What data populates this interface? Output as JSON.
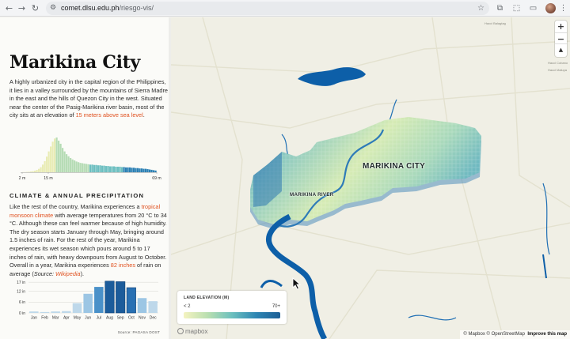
{
  "browser": {
    "url_host": "comet.dlsu.edu.ph",
    "url_path": "/riesgo-vis/",
    "back_glyph": "←",
    "forward_glyph": "→",
    "reload_glyph": "↻",
    "tune_glyph": "⚙",
    "star_glyph": "☆",
    "ext_glyph": "⧉",
    "ext2_glyph": "⬚",
    "sidebar_glyph": "▭",
    "menu_glyph": "⋮"
  },
  "panel": {
    "title": "Marikina City",
    "intro_pre": "A highly urbanized city in the capital region of the Philippines, it lies in a valley surrounded by the mountains of Sierra Madre in the east and the hills of Quezon City in the west. Situated near the center of the Pasig-Marikina river basin, most of the city sits at an elevation of ",
    "intro_link": "15 meters above sea level",
    "intro_post": ".",
    "section_heading": "CLIMATE & ANNUAL PRECIPITATION",
    "climate_pre": "Like the rest of the country, Marikina experiences a ",
    "climate_link1": "tropical monsoon climate",
    "climate_mid1": " with average temperatures from 20 °C to 34 °C. Although these can feel warmer because of high humidity. The dry season starts January through May, bringing around 1.5 inches of rain. For the rest of the year, Marikina experiences its wet season which pours around 5 to 17 inches of rain, with heavy downpours from August to October. Overall in a year, Marikina experiences ",
    "climate_link2": "82 inches",
    "climate_mid2": " of rain on average (",
    "climate_source_word": "Source:",
    "climate_link3": "Wikipedia",
    "climate_end": ").",
    "source_note": "Source: PAGASA DOST"
  },
  "elevation_histogram": {
    "tick_labels": [
      "2 m",
      "15 m",
      "69 m"
    ],
    "tick_values": [
      2,
      15,
      69
    ],
    "x_range": [
      2,
      69
    ],
    "bins": [
      0.4,
      0.6,
      0.9,
      1.4,
      2.2,
      3.2,
      4.6,
      6.6,
      9.8,
      14.5,
      22,
      32,
      45,
      60,
      74,
      88,
      97,
      100,
      91,
      82,
      70,
      60,
      52,
      46,
      41,
      37,
      34,
      31,
      29,
      27,
      26,
      25,
      24,
      23,
      22,
      22,
      21,
      21,
      20,
      20,
      19,
      19,
      18,
      18,
      17,
      17,
      17,
      16,
      16,
      16,
      15,
      15,
      14,
      14,
      14,
      13,
      13,
      12,
      12,
      11,
      11,
      10,
      10,
      9,
      8,
      7,
      6,
      5
    ],
    "bin_colors": [
      "#e9ecb5",
      "#b6dcb5",
      "#6cbfc0",
      "#2a7fb3"
    ]
  },
  "chart_data": {
    "type": "bar",
    "categories": [
      "Jan",
      "Feb",
      "Mar",
      "Apr",
      "May",
      "Jun",
      "Jul",
      "Aug",
      "Sep",
      "Oct",
      "Nov",
      "Dec"
    ],
    "values": [
      0.8,
      0.5,
      0.8,
      1.0,
      5.4,
      10.6,
      14.4,
      17.6,
      17.3,
      14.0,
      8.2,
      6.5
    ],
    "y_ticks": [
      0,
      6,
      12,
      17
    ],
    "y_tick_labels": [
      "0 in",
      "6 in",
      "12 in",
      "17 in"
    ],
    "ylim": [
      0,
      17.5
    ],
    "colors": [
      "#bed8ea",
      "#bed8ea",
      "#bed8ea",
      "#bed8ea",
      "#bed8ea",
      "#9cc6e4",
      "#4a91c9",
      "#1c5c9b",
      "#1c5c9b",
      "#2870b3",
      "#9cc6e4",
      "#bed8ea"
    ]
  },
  "map": {
    "city_label": "MARIKINA CITY",
    "river_label": "MARIKINA RIVER",
    "place_labels": [
      "Hacci Balagtag",
      "Hacci Cobano",
      "Hacci Maluya"
    ],
    "zoom_in": "+",
    "zoom_out": "−",
    "compass": "▲",
    "legend": {
      "title": "LAND ELEVATION (M)",
      "min_label": "< 2",
      "max_label": "70+"
    },
    "mapbox_logo": "mapbox",
    "attribution_1": "© Mapbox © OpenStreetMap",
    "attribution_2": "Improve this map",
    "colors": {
      "river": "#0d5fa8",
      "land": "#f0efe5",
      "road": "#e2e0cf"
    }
  }
}
